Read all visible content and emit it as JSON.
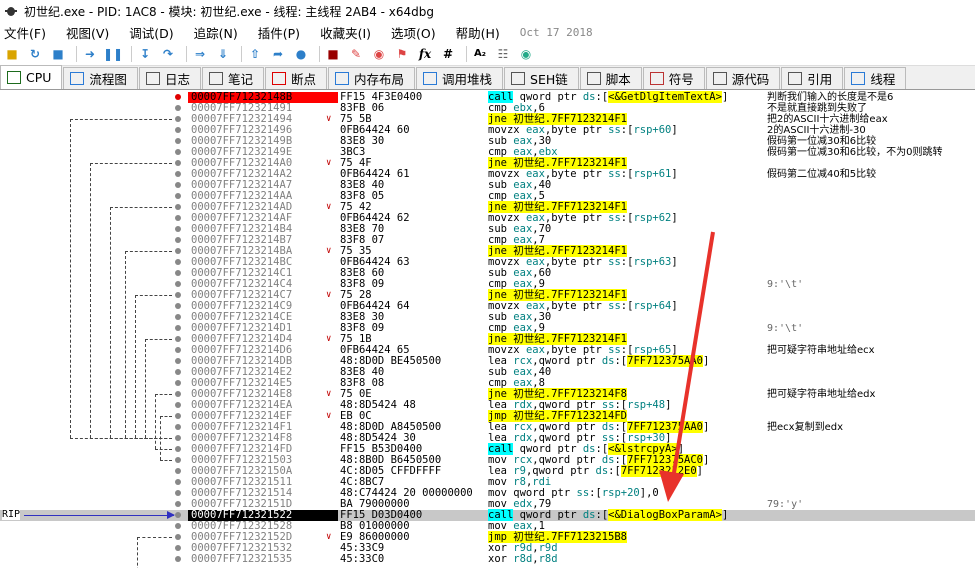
{
  "window": {
    "title": "初世纪.exe - PID: 1AC8 - 模块: 初世纪.exe - 线程: 主线程 2AB4 - x64dbg"
  },
  "menu": {
    "items": [
      "文件(F)",
      "视图(V)",
      "调试(D)",
      "追踪(N)",
      "插件(P)",
      "收藏夹(I)",
      "选项(O)",
      "帮助(H)"
    ],
    "date": "Oct 17 2018"
  },
  "tabs": [
    {
      "label": "CPU",
      "icon": "cpu-icon",
      "active": true
    },
    {
      "label": "流程图",
      "icon": "graph-icon"
    },
    {
      "label": "日志",
      "icon": "log-icon"
    },
    {
      "label": "笔记",
      "icon": "notes-icon"
    },
    {
      "label": "断点",
      "icon": "breakpoint-icon"
    },
    {
      "label": "内存布局",
      "icon": "memory-icon"
    },
    {
      "label": "调用堆栈",
      "icon": "callstack-icon"
    },
    {
      "label": "SEH链",
      "icon": "seh-icon"
    },
    {
      "label": "脚本",
      "icon": "script-icon"
    },
    {
      "label": "符号",
      "icon": "symbol-icon"
    },
    {
      "label": "源代码",
      "icon": "source-icon"
    },
    {
      "label": "引用",
      "icon": "references-icon"
    },
    {
      "label": "线程",
      "icon": "threads-icon"
    }
  ],
  "rip_label": "RIP",
  "disasm": [
    {
      "addr": "00007FF71232148B",
      "bytes": "FF15 4F3E0400",
      "ins": [
        [
          "k-call",
          "call"
        ],
        [
          "",
          " qword ptr "
        ],
        [
          "ssb",
          "ds"
        ],
        [
          "",
          ":["
        ],
        [
          "lbl",
          "<&GetDlgItemTextA>"
        ],
        [
          "",
          "]"
        ]
      ],
      "comment": "判断我们输入的长度是不是6",
      "addr_style": "hl",
      "bp": "red"
    },
    {
      "addr": "00007FF712321491",
      "bytes": "83FB 06",
      "ins": [
        [
          "",
          "cmp "
        ],
        [
          "reg",
          "ebx"
        ],
        [
          "",
          ","
        ],
        [
          "",
          "6"
        ]
      ],
      "comment": "不是就直接跳到失败了"
    },
    {
      "addr": "00007FF712321494",
      "bytes": "75 5B",
      "jmp": "v",
      "ins": [
        [
          "k-j",
          "jne"
        ],
        [
          "",
          ""
        ],
        [
          "lbl",
          " 初世纪.7FF7123214F1"
        ]
      ],
      "comment": "把2的ASCII十六进制给eax"
    },
    {
      "addr": "00007FF712321496",
      "bytes": "0FB64424 60",
      "ins": [
        [
          "",
          "movzx "
        ],
        [
          "reg",
          "eax"
        ],
        [
          "",
          ",byte ptr "
        ],
        [
          "ssb",
          "ss"
        ],
        [
          "",
          ":["
        ],
        [
          "reg",
          "rsp+60"
        ],
        [
          "",
          "]"
        ]
      ],
      "comment": "2的ASCII十六进制-30"
    },
    {
      "addr": "00007FF71232149B",
      "bytes": "83E8 30",
      "ins": [
        [
          "",
          "sub "
        ],
        [
          "reg",
          "eax"
        ],
        [
          "",
          ",30"
        ]
      ],
      "comment": "假码第一位减30和6比较"
    },
    {
      "addr": "00007FF71232149E",
      "bytes": "3BC3",
      "ins": [
        [
          "",
          "cmp "
        ],
        [
          "reg",
          "eax"
        ],
        [
          "",
          ","
        ],
        [
          "reg",
          "ebx"
        ]
      ],
      "comment": "假码第一位减30和6比较，不为0则跳转"
    },
    {
      "addr": "00007FF7123214A0",
      "bytes": "75 4F",
      "jmp": "v",
      "ins": [
        [
          "k-j",
          "jne"
        ],
        [
          "lbl",
          " 初世纪.7FF7123214F1"
        ]
      ],
      "comment": ""
    },
    {
      "addr": "00007FF7123214A2",
      "bytes": "0FB64424 61",
      "ins": [
        [
          "",
          "movzx "
        ],
        [
          "reg",
          "eax"
        ],
        [
          "",
          ",byte ptr "
        ],
        [
          "ssb",
          "ss"
        ],
        [
          "",
          ":["
        ],
        [
          "reg",
          "rsp+61"
        ],
        [
          "",
          "]"
        ]
      ],
      "comment": "假码第二位减40和5比较"
    },
    {
      "addr": "00007FF7123214A7",
      "bytes": "83E8 40",
      "ins": [
        [
          "",
          "sub "
        ],
        [
          "reg",
          "eax"
        ],
        [
          "",
          ",40"
        ]
      ],
      "comment": ""
    },
    {
      "addr": "00007FF7123214AA",
      "bytes": "83F8 05",
      "ins": [
        [
          "",
          "cmp "
        ],
        [
          "reg",
          "eax"
        ],
        [
          "",
          ",5"
        ]
      ],
      "comment": ""
    },
    {
      "addr": "00007FF7123214AD",
      "bytes": "75 42",
      "jmp": "v",
      "ins": [
        [
          "k-j",
          "jne"
        ],
        [
          "lbl",
          " 初世纪.7FF7123214F1"
        ]
      ],
      "comment": ""
    },
    {
      "addr": "00007FF7123214AF",
      "bytes": "0FB64424 62",
      "ins": [
        [
          "",
          "movzx "
        ],
        [
          "reg",
          "eax"
        ],
        [
          "",
          ",byte ptr "
        ],
        [
          "ssb",
          "ss"
        ],
        [
          "",
          ":["
        ],
        [
          "reg",
          "rsp+62"
        ],
        [
          "",
          "]"
        ]
      ],
      "comment": ""
    },
    {
      "addr": "00007FF7123214B4",
      "bytes": "83E8 70",
      "ins": [
        [
          "",
          "sub "
        ],
        [
          "reg",
          "eax"
        ],
        [
          "",
          ",70"
        ]
      ],
      "comment": ""
    },
    {
      "addr": "00007FF7123214B7",
      "bytes": "83F8 07",
      "ins": [
        [
          "",
          "cmp "
        ],
        [
          "reg",
          "eax"
        ],
        [
          "",
          ",7"
        ]
      ],
      "comment": ""
    },
    {
      "addr": "00007FF7123214BA",
      "bytes": "75 35",
      "jmp": "v",
      "ins": [
        [
          "k-j",
          "jne"
        ],
        [
          "lbl",
          " 初世纪.7FF7123214F1"
        ]
      ],
      "comment": ""
    },
    {
      "addr": "00007FF7123214BC",
      "bytes": "0FB64424 63",
      "ins": [
        [
          "",
          "movzx "
        ],
        [
          "reg",
          "eax"
        ],
        [
          "",
          ",byte ptr "
        ],
        [
          "ssb",
          "ss"
        ],
        [
          "",
          ":["
        ],
        [
          "reg",
          "rsp+63"
        ],
        [
          "",
          "]"
        ]
      ],
      "comment": ""
    },
    {
      "addr": "00007FF7123214C1",
      "bytes": "83E8 60",
      "ins": [
        [
          "",
          "sub "
        ],
        [
          "reg",
          "eax"
        ],
        [
          "",
          ",60"
        ]
      ],
      "comment": ""
    },
    {
      "addr": "00007FF7123214C4",
      "bytes": "83F8 09",
      "ins": [
        [
          "",
          "cmp "
        ],
        [
          "reg",
          "eax"
        ],
        [
          "",
          ",9"
        ]
      ],
      "comment": "9:'\\t'",
      "comment_gray": true
    },
    {
      "addr": "00007FF7123214C7",
      "bytes": "75 28",
      "jmp": "v",
      "ins": [
        [
          "k-j",
          "jne"
        ],
        [
          "lbl",
          " 初世纪.7FF7123214F1"
        ]
      ],
      "comment": ""
    },
    {
      "addr": "00007FF7123214C9",
      "bytes": "0FB64424 64",
      "ins": [
        [
          "",
          "movzx "
        ],
        [
          "reg",
          "eax"
        ],
        [
          "",
          ",byte ptr "
        ],
        [
          "ssb",
          "ss"
        ],
        [
          "",
          ":["
        ],
        [
          "reg",
          "rsp+64"
        ],
        [
          "",
          "]"
        ]
      ],
      "comment": ""
    },
    {
      "addr": "00007FF7123214CE",
      "bytes": "83E8 30",
      "ins": [
        [
          "",
          "sub "
        ],
        [
          "reg",
          "eax"
        ],
        [
          "",
          ",30"
        ]
      ],
      "comment": ""
    },
    {
      "addr": "00007FF7123214D1",
      "bytes": "83F8 09",
      "ins": [
        [
          "",
          "cmp "
        ],
        [
          "reg",
          "eax"
        ],
        [
          "",
          ",9"
        ]
      ],
      "comment": "9:'\\t'",
      "comment_gray": true
    },
    {
      "addr": "00007FF7123214D4",
      "bytes": "75 1B",
      "jmp": "v",
      "ins": [
        [
          "k-j",
          "jne"
        ],
        [
          "lbl",
          " 初世纪.7FF7123214F1"
        ]
      ],
      "comment": ""
    },
    {
      "addr": "00007FF7123214D6",
      "bytes": "0FB64424 65",
      "ins": [
        [
          "",
          "movzx "
        ],
        [
          "reg",
          "eax"
        ],
        [
          "",
          ",byte ptr "
        ],
        [
          "ssb",
          "ss"
        ],
        [
          "",
          ":["
        ],
        [
          "reg",
          "rsp+65"
        ],
        [
          "",
          "]"
        ]
      ],
      "comment": "把可疑字符串地址给ecx"
    },
    {
      "addr": "00007FF7123214DB",
      "bytes": "48:8D0D BE450500",
      "ins": [
        [
          "",
          "lea "
        ],
        [
          "reg",
          "rcx"
        ],
        [
          "",
          ",qword ptr "
        ],
        [
          "ssb",
          "ds"
        ],
        [
          "",
          ":["
        ],
        [
          "lbl",
          "7FF712375AA0"
        ],
        [
          "",
          "]"
        ]
      ],
      "comment": ""
    },
    {
      "addr": "00007FF7123214E2",
      "bytes": "83E8 40",
      "ins": [
        [
          "",
          "sub "
        ],
        [
          "reg",
          "eax"
        ],
        [
          "",
          ",40"
        ]
      ],
      "comment": ""
    },
    {
      "addr": "00007FF7123214E5",
      "bytes": "83F8 08",
      "ins": [
        [
          "",
          "cmp "
        ],
        [
          "reg",
          "eax"
        ],
        [
          "",
          ",8"
        ]
      ],
      "comment": ""
    },
    {
      "addr": "00007FF7123214E8",
      "bytes": "75 0E",
      "jmp": "v",
      "ins": [
        [
          "k-j",
          "jne"
        ],
        [
          "lbl",
          " 初世纪.7FF7123214F8"
        ]
      ],
      "comment": "把可疑字符串地址给edx"
    },
    {
      "addr": "00007FF7123214EA",
      "bytes": "48:8D5424 48",
      "ins": [
        [
          "",
          "lea "
        ],
        [
          "reg",
          "rdx"
        ],
        [
          "",
          ",qword ptr "
        ],
        [
          "ssb",
          "ss"
        ],
        [
          "",
          ":["
        ],
        [
          "reg",
          "rsp+48"
        ],
        [
          "",
          "]"
        ]
      ],
      "comment": ""
    },
    {
      "addr": "00007FF7123214EF",
      "bytes": "EB 0C",
      "jmp": "v",
      "ins": [
        [
          "k-j",
          "jmp"
        ],
        [
          "lbl",
          " 初世纪.7FF7123214FD"
        ]
      ],
      "comment": ""
    },
    {
      "addr": "00007FF7123214F1",
      "bytes": "48:8D0D A8450500",
      "ins": [
        [
          "",
          "lea "
        ],
        [
          "reg",
          "rcx"
        ],
        [
          "",
          ",qword ptr "
        ],
        [
          "ssb",
          "ds"
        ],
        [
          "",
          ":["
        ],
        [
          "lbl",
          "7FF712375AA0"
        ],
        [
          "",
          "]"
        ]
      ],
      "comment": "把ecx复制到edx"
    },
    {
      "addr": "00007FF7123214F8",
      "bytes": "48:8D5424 30",
      "ins": [
        [
          "",
          "lea "
        ],
        [
          "reg",
          "rdx"
        ],
        [
          "",
          ",qword ptr "
        ],
        [
          "ssb",
          "ss"
        ],
        [
          "",
          ":["
        ],
        [
          "reg",
          "rsp+30"
        ],
        [
          "",
          "]"
        ]
      ],
      "comment": ""
    },
    {
      "addr": "00007FF7123214FD",
      "bytes": "FF15 B53D0400",
      "ins": [
        [
          "k-call",
          "call"
        ],
        [
          "",
          " qword ptr "
        ],
        [
          "ssb",
          "ds"
        ],
        [
          "",
          ":["
        ],
        [
          "lbl",
          "<&lstrcpyA>"
        ],
        [
          "",
          "]"
        ]
      ],
      "comment": ""
    },
    {
      "addr": "00007FF712321503",
      "bytes": "48:8B0D B6450500",
      "ins": [
        [
          "",
          "mov "
        ],
        [
          "reg",
          "rcx"
        ],
        [
          "",
          ",qword ptr "
        ],
        [
          "ssb",
          "ds"
        ],
        [
          "",
          ":["
        ],
        [
          "lbl",
          "7FF712375AC0"
        ],
        [
          "",
          "]"
        ]
      ],
      "comment": ""
    },
    {
      "addr": "00007FF71232150A",
      "bytes": "4C:8D05 CFFDFFFF",
      "ins": [
        [
          "",
          "lea "
        ],
        [
          "reg",
          "r9"
        ],
        [
          "",
          ",qword ptr "
        ],
        [
          "ssb",
          "ds"
        ],
        [
          "",
          ":["
        ],
        [
          "lbl",
          "7FF7123212E0"
        ],
        [
          "",
          "]"
        ]
      ],
      "comment": ""
    },
    {
      "addr": "00007FF712321511",
      "bytes": "4C:8BC7",
      "ins": [
        [
          "",
          "mov "
        ],
        [
          "reg",
          "r8"
        ],
        [
          "",
          ","
        ],
        [
          "reg",
          "rdi"
        ]
      ],
      "comment": ""
    },
    {
      "addr": "00007FF712321514",
      "bytes": "48:C74424 20 00000000",
      "ins": [
        [
          "",
          "mov qword ptr "
        ],
        [
          "ssb",
          "ss"
        ],
        [
          "",
          ":["
        ],
        [
          "reg",
          "rsp+20"
        ],
        [
          "",
          "],0"
        ]
      ],
      "comment": ""
    },
    {
      "addr": "00007FF71232151D",
      "bytes": "BA 79000000",
      "ins": [
        [
          "",
          "mov "
        ],
        [
          "reg",
          "edx"
        ],
        [
          "",
          ",79"
        ]
      ],
      "comment": "79:'y'",
      "comment_gray": true
    },
    {
      "addr": "00007FF712321522",
      "bytes": "FF15 D03D0400",
      "ins": [
        [
          "k-call",
          "call"
        ],
        [
          "",
          " qword ptr "
        ],
        [
          "ssb",
          "ds"
        ],
        [
          "",
          ":["
        ],
        [
          "lbl",
          "<&DialogBoxParamA>"
        ],
        [
          "",
          "]"
        ]
      ],
      "comment": "",
      "addr_style": "cur",
      "selected": true
    },
    {
      "addr": "00007FF712321528",
      "bytes": "B8 01000000",
      "ins": [
        [
          "",
          "mov "
        ],
        [
          "reg",
          "eax"
        ],
        [
          "",
          ",1"
        ]
      ],
      "comment": ""
    },
    {
      "addr": "00007FF71232152D",
      "bytes": "E9 86000000",
      "jmp": "v",
      "ins": [
        [
          "k-j",
          "jmp"
        ],
        [
          "lbl",
          " 初世纪.7FF7123215B8"
        ]
      ],
      "comment": ""
    },
    {
      "addr": "00007FF712321532",
      "bytes": "45:33C9",
      "ins": [
        [
          "",
          "xor "
        ],
        [
          "reg",
          "r9d"
        ],
        [
          "",
          ","
        ],
        [
          "reg",
          "r9d"
        ]
      ],
      "comment": ""
    },
    {
      "addr": "00007FF712321535",
      "bytes": "45:33C0",
      "ins": [
        [
          "",
          "xor "
        ],
        [
          "reg",
          "r8d"
        ],
        [
          "",
          ","
        ],
        [
          "reg",
          "r8d"
        ]
      ],
      "comment": ""
    }
  ]
}
